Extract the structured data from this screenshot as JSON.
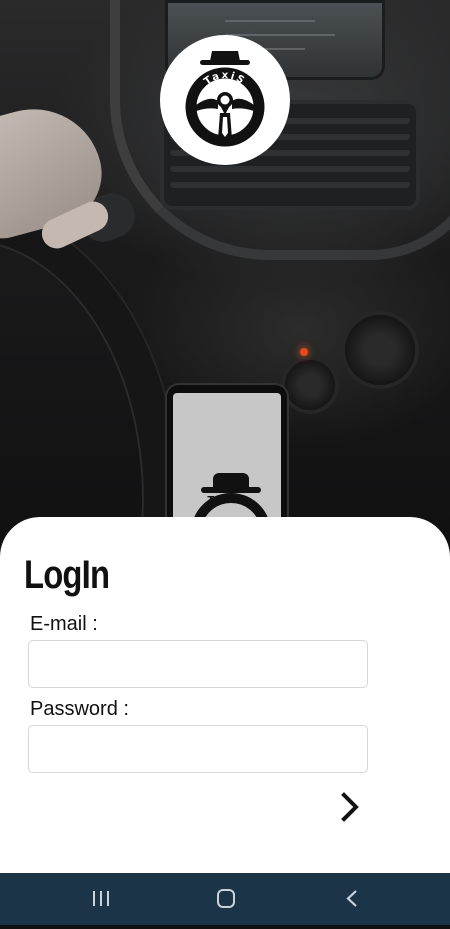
{
  "app": {
    "logo_text": "TaxiS"
  },
  "login": {
    "title": "LogIn",
    "email_label": "E-mail :",
    "email_value": "",
    "password_label": "Password :",
    "password_value": ""
  },
  "navbar": {
    "recents": "recents-icon",
    "home": "home-icon",
    "back": "back-icon"
  },
  "colors": {
    "navbar": "#1b3448",
    "card": "#ffffff",
    "text": "#111111"
  }
}
